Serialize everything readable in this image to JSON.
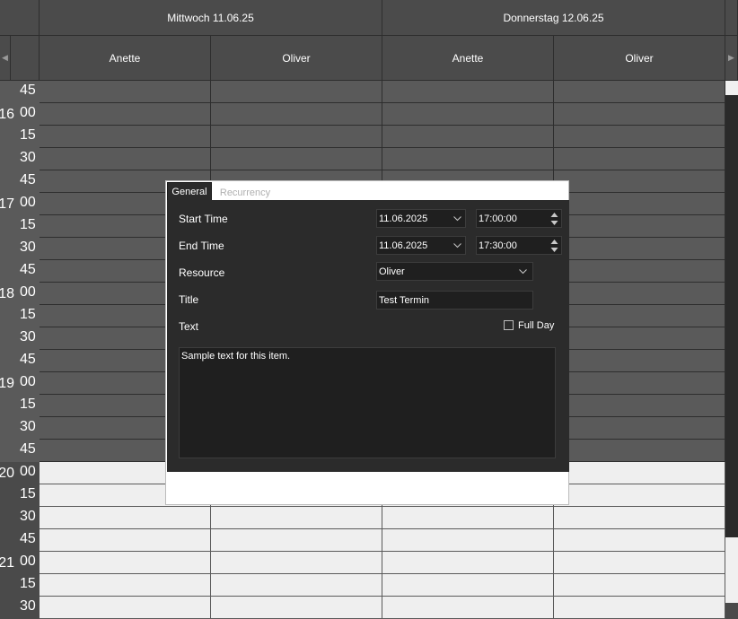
{
  "days": [
    "Mittwoch 11.06.25",
    "Donnerstag 12.06.25"
  ],
  "resources": [
    "Anette",
    "Oliver",
    "Anette",
    "Oliver"
  ],
  "nav": {
    "left": "◀",
    "right": "▶"
  },
  "time_rows": [
    {
      "hour": "",
      "minute": "45",
      "shade": "dark"
    },
    {
      "hour": "16",
      "minute": "00",
      "shade": "dark"
    },
    {
      "hour": "",
      "minute": "15",
      "shade": "dark"
    },
    {
      "hour": "",
      "minute": "30",
      "shade": "dark"
    },
    {
      "hour": "",
      "minute": "45",
      "shade": "dark"
    },
    {
      "hour": "17",
      "minute": "00",
      "shade": "dark"
    },
    {
      "hour": "",
      "minute": "15",
      "shade": "dark"
    },
    {
      "hour": "",
      "minute": "30",
      "shade": "dark"
    },
    {
      "hour": "",
      "minute": "45",
      "shade": "dark"
    },
    {
      "hour": "18",
      "minute": "00",
      "shade": "dark"
    },
    {
      "hour": "",
      "minute": "15",
      "shade": "dark"
    },
    {
      "hour": "",
      "minute": "30",
      "shade": "dark"
    },
    {
      "hour": "",
      "minute": "45",
      "shade": "dark"
    },
    {
      "hour": "19",
      "minute": "00",
      "shade": "dark"
    },
    {
      "hour": "",
      "minute": "15",
      "shade": "dark"
    },
    {
      "hour": "",
      "minute": "30",
      "shade": "dark"
    },
    {
      "hour": "",
      "minute": "45",
      "shade": "dark"
    },
    {
      "hour": "20",
      "minute": "00",
      "shade": "light"
    },
    {
      "hour": "",
      "minute": "15",
      "shade": "light"
    },
    {
      "hour": "",
      "minute": "30",
      "shade": "light"
    },
    {
      "hour": "",
      "minute": "45",
      "shade": "light"
    },
    {
      "hour": "21",
      "minute": "00",
      "shade": "light"
    },
    {
      "hour": "",
      "minute": "15",
      "shade": "light"
    },
    {
      "hour": "",
      "minute": "30",
      "shade": "light"
    }
  ],
  "dialog": {
    "tabs": {
      "general": "General",
      "recurrency": "Recurrency"
    },
    "start_time": {
      "label": "Start Time",
      "date": "11.06.2025",
      "time": "17:00:00"
    },
    "end_time": {
      "label": "End Time",
      "date": "11.06.2025",
      "time": "17:30:00"
    },
    "resource": {
      "label": "Resource",
      "value": "Oliver"
    },
    "title": {
      "label": "Title",
      "value": "Test Termin"
    },
    "text": {
      "label": "Text",
      "value": "Sample text for this item."
    },
    "full_day": {
      "label": "Full Day",
      "checked": false
    }
  },
  "colors": {
    "grid_dark": "#5a5a5a",
    "grid_light": "#efefef",
    "header": "#4b4b4b",
    "dialog_bg": "#2b2b2b",
    "field_bg": "#1f1f1f"
  }
}
